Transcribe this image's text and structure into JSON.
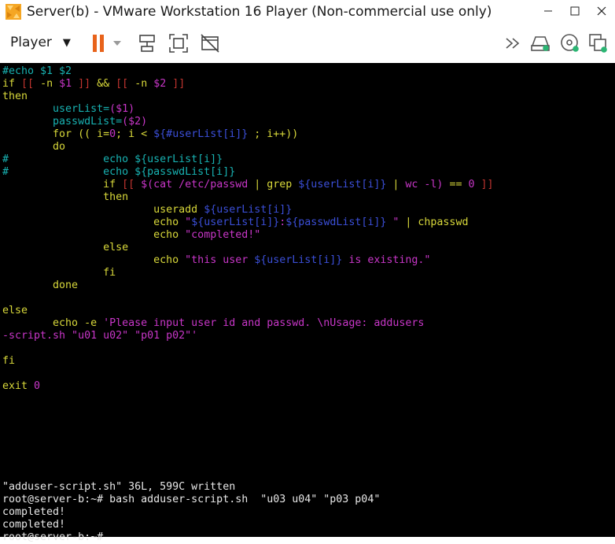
{
  "window": {
    "title": "Server(b) - VMware Workstation 16 Player (Non-commercial use only)",
    "controls": [
      "minimize-icon",
      "maximize-icon",
      "close-icon"
    ]
  },
  "toolbar": {
    "player_label": "Player",
    "icons": [
      "pause-icon",
      "dropdown-arrow-icon",
      "send-ctrl-alt-del-icon",
      "fullscreen-icon",
      "unity-icon",
      "forward-icon",
      "network-icon",
      "cd-icon",
      "removable-device-icon"
    ],
    "pause_color": "#e8631b"
  },
  "terminal": {
    "lines": [
      [
        {
          "t": "#echo $1 $2",
          "c": "cyan"
        }
      ],
      [
        {
          "t": "if ",
          "c": "yellow"
        },
        {
          "t": "[[ ",
          "c": "red"
        },
        {
          "t": "-n ",
          "c": "yellow"
        },
        {
          "t": "$1",
          "c": "mag"
        },
        {
          "t": " ]]",
          "c": "red"
        },
        {
          "t": " && ",
          "c": "yellow"
        },
        {
          "t": "[[ ",
          "c": "red"
        },
        {
          "t": "-n ",
          "c": "yellow"
        },
        {
          "t": "$2",
          "c": "mag"
        },
        {
          "t": " ]]",
          "c": "red"
        }
      ],
      [
        {
          "t": "then",
          "c": "yellow"
        }
      ],
      [
        {
          "t": "        userList=",
          "c": "cyan"
        },
        {
          "t": "($1)",
          "c": "mag"
        }
      ],
      [
        {
          "t": "        passwdList=",
          "c": "cyan"
        },
        {
          "t": "($2)",
          "c": "mag"
        }
      ],
      [
        {
          "t": "        for",
          "c": "yellow"
        },
        {
          "t": " (( i=",
          "c": "yellow"
        },
        {
          "t": "0",
          "c": "mag"
        },
        {
          "t": "; i < ",
          "c": "yellow"
        },
        {
          "t": "${#userList[i]}",
          "c": "blue"
        },
        {
          "t": " ; i++))",
          "c": "yellow"
        }
      ],
      [
        {
          "t": "        do",
          "c": "yellow"
        }
      ],
      [
        {
          "t": "#               echo ${userList[i]}",
          "c": "cyan"
        }
      ],
      [
        {
          "t": "#               echo ${passwdList[i]}",
          "c": "cyan"
        }
      ],
      [
        {
          "t": "                if ",
          "c": "yellow"
        },
        {
          "t": "[[ ",
          "c": "red"
        },
        {
          "t": "$(cat /etc/passwd",
          "c": "mag"
        },
        {
          "t": " | ",
          "c": "yellow"
        },
        {
          "t": "grep ",
          "c": "yellow"
        },
        {
          "t": "${userList[i]}",
          "c": "blue"
        },
        {
          "t": " | ",
          "c": "yellow"
        },
        {
          "t": "wc -l)",
          "c": "mag"
        },
        {
          "t": " == ",
          "c": "yellow"
        },
        {
          "t": "0",
          "c": "mag"
        },
        {
          "t": " ]]",
          "c": "red"
        }
      ],
      [
        {
          "t": "                then",
          "c": "yellow"
        }
      ],
      [
        {
          "t": "                        useradd ",
          "c": "yellow"
        },
        {
          "t": "${userList[i]}",
          "c": "blue"
        }
      ],
      [
        {
          "t": "                        echo ",
          "c": "yellow"
        },
        {
          "t": "\"",
          "c": "mag"
        },
        {
          "t": "${userList[i]}",
          "c": "blue"
        },
        {
          "t": ":",
          "c": "mag"
        },
        {
          "t": "${passwdList[i]}",
          "c": "blue"
        },
        {
          "t": " \"",
          "c": "mag"
        },
        {
          "t": " | chpasswd",
          "c": "yellow"
        }
      ],
      [
        {
          "t": "                        echo ",
          "c": "yellow"
        },
        {
          "t": "\"completed!\"",
          "c": "mag"
        }
      ],
      [
        {
          "t": "                else",
          "c": "yellow"
        }
      ],
      [
        {
          "t": "                        echo ",
          "c": "yellow"
        },
        {
          "t": "\"this user ",
          "c": "mag"
        },
        {
          "t": "${userList[i]}",
          "c": "blue"
        },
        {
          "t": " is existing.\"",
          "c": "mag"
        }
      ],
      [
        {
          "t": "                fi",
          "c": "yellow"
        }
      ],
      [
        {
          "t": "        done",
          "c": "yellow"
        }
      ],
      [],
      [
        {
          "t": "else",
          "c": "yellow"
        }
      ],
      [
        {
          "t": "        echo ",
          "c": "yellow"
        },
        {
          "t": "-e ",
          "c": "yellow"
        },
        {
          "t": "'Please input user id and passwd. \\nUsage: addusers",
          "c": "mag"
        }
      ],
      [
        {
          "t": "-script.sh \"u01 u02\" \"p01 p02\"'",
          "c": "mag"
        }
      ],
      [],
      [
        {
          "t": "fi",
          "c": "yellow"
        }
      ],
      [],
      [
        {
          "t": "exit ",
          "c": "yellow"
        },
        {
          "t": "0",
          "c": "mag"
        }
      ],
      [],
      [],
      [],
      [],
      [],
      [],
      [],
      [
        {
          "t": "\"adduser-script.sh\" 36L, 599C written",
          "c": "white"
        }
      ],
      [
        {
          "t": "root@server-b:~# bash adduser-script.sh  \"u03 u04\" \"p03 p04\"",
          "c": "white"
        }
      ],
      [
        {
          "t": "completed!",
          "c": "white"
        }
      ],
      [
        {
          "t": "completed!",
          "c": "white"
        }
      ],
      [
        {
          "t": "root@server-b:~#",
          "c": "white"
        }
      ]
    ]
  }
}
